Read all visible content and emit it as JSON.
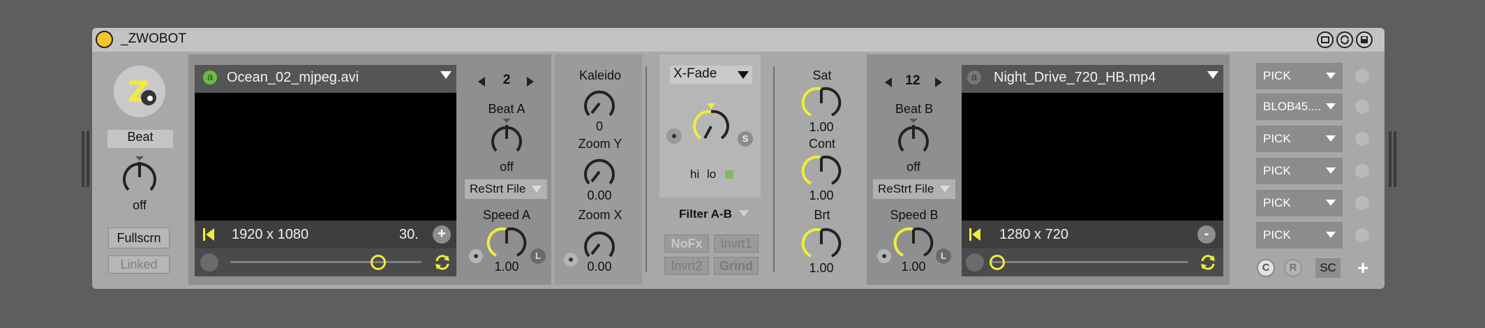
{
  "device": {
    "title": "_ZWOBOT"
  },
  "left_panel": {
    "beat_label": "Beat",
    "beat_value": "off",
    "fullscreen_label": "Fullscrn",
    "linked_label": "Linked"
  },
  "deck_a": {
    "badge": "a",
    "filename": "Ocean_02_mjpeg.avi",
    "resolution": "1920 x 1080",
    "fps": "30.",
    "add_label": "+",
    "position": 0.78,
    "page": "2",
    "beat_label": "Beat A",
    "beat_value": "off",
    "restart_label": "ReStrt File",
    "speed_label": "Speed A",
    "speed_value": "1.00",
    "loop_label": "L"
  },
  "fx_a": {
    "kaleido_label": "Kaleido",
    "kaleido_value": "0",
    "zoom_y_label": "Zoom Y",
    "zoom_y_value": "0.00",
    "zoom_x_label": "Zoom X",
    "zoom_x_value": "0.00"
  },
  "crossfade": {
    "mode": "X-Fade",
    "s_label": "S",
    "hi_label": "hi",
    "lo_label": "lo",
    "filter_label": "Filter A-B",
    "nofx_label": "NoFx",
    "invrt1_label": "Invrt1",
    "invrt2_label": "Invrt2",
    "grind_label": "Grind"
  },
  "color": {
    "sat_label": "Sat",
    "sat_value": "1.00",
    "cont_label": "Cont",
    "cont_value": "1.00",
    "brt_label": "Brt",
    "brt_value": "1.00"
  },
  "deck_b": {
    "badge": "a",
    "filename": "Night_Drive_720_HB.mp4",
    "resolution": "1280 x 720",
    "remove_label": "-",
    "position": 0.0,
    "page": "12",
    "beat_label": "Beat B",
    "beat_value": "off",
    "restart_label": "ReStrt File",
    "speed_label": "Speed B",
    "speed_value": "1.00",
    "loop_label": "L"
  },
  "presets": {
    "items": [
      "PICK",
      "BLOB45....",
      "PICK",
      "PICK",
      "PICK",
      "PICK"
    ],
    "c_label": "C",
    "r_label": "R",
    "sc_label": "SC",
    "plus_label": "+"
  },
  "colors": {
    "accent": "#f2ec3a",
    "green": "#6dbb45",
    "titlebar": "#c3c3c3",
    "device_bg": "#a8a8a8"
  }
}
